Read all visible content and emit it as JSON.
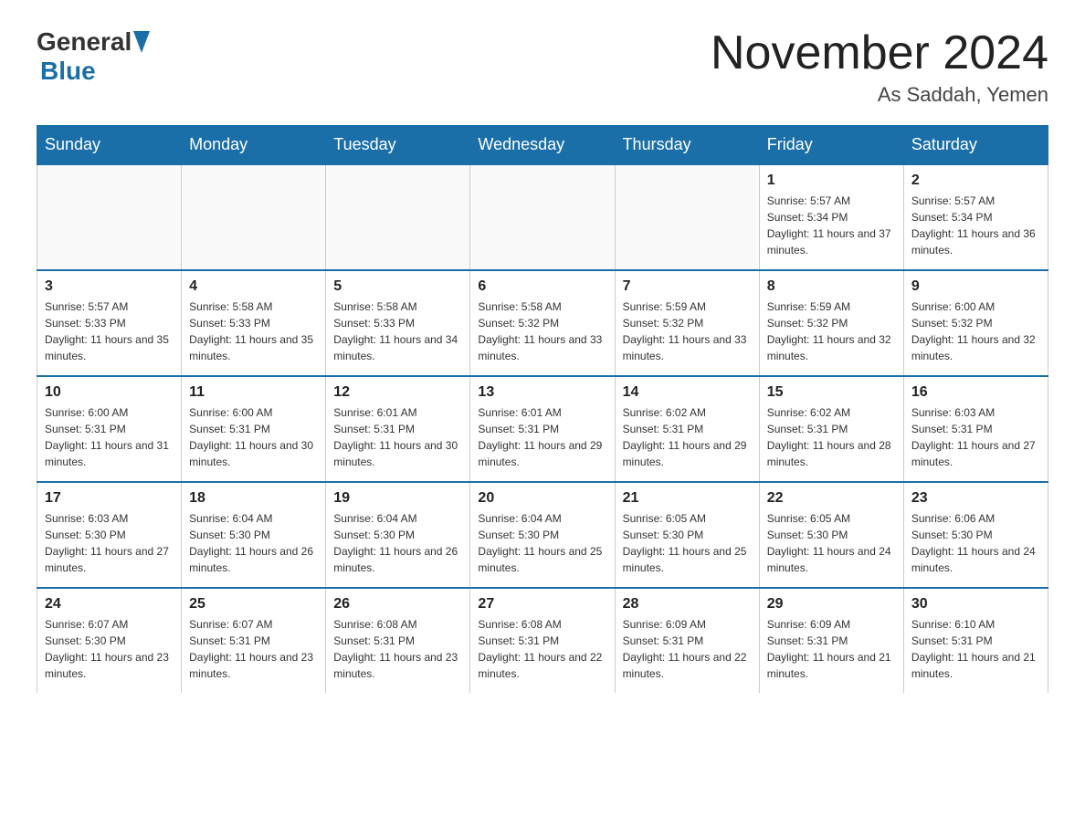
{
  "header": {
    "logo_general": "General",
    "logo_blue": "Blue",
    "month_title": "November 2024",
    "location": "As Saddah, Yemen"
  },
  "weekdays": [
    "Sunday",
    "Monday",
    "Tuesday",
    "Wednesday",
    "Thursday",
    "Friday",
    "Saturday"
  ],
  "weeks": [
    [
      {
        "day": "",
        "sunrise": "",
        "sunset": "",
        "daylight": ""
      },
      {
        "day": "",
        "sunrise": "",
        "sunset": "",
        "daylight": ""
      },
      {
        "day": "",
        "sunrise": "",
        "sunset": "",
        "daylight": ""
      },
      {
        "day": "",
        "sunrise": "",
        "sunset": "",
        "daylight": ""
      },
      {
        "day": "",
        "sunrise": "",
        "sunset": "",
        "daylight": ""
      },
      {
        "day": "1",
        "sunrise": "Sunrise: 5:57 AM",
        "sunset": "Sunset: 5:34 PM",
        "daylight": "Daylight: 11 hours and 37 minutes."
      },
      {
        "day": "2",
        "sunrise": "Sunrise: 5:57 AM",
        "sunset": "Sunset: 5:34 PM",
        "daylight": "Daylight: 11 hours and 36 minutes."
      }
    ],
    [
      {
        "day": "3",
        "sunrise": "Sunrise: 5:57 AM",
        "sunset": "Sunset: 5:33 PM",
        "daylight": "Daylight: 11 hours and 35 minutes."
      },
      {
        "day": "4",
        "sunrise": "Sunrise: 5:58 AM",
        "sunset": "Sunset: 5:33 PM",
        "daylight": "Daylight: 11 hours and 35 minutes."
      },
      {
        "day": "5",
        "sunrise": "Sunrise: 5:58 AM",
        "sunset": "Sunset: 5:33 PM",
        "daylight": "Daylight: 11 hours and 34 minutes."
      },
      {
        "day": "6",
        "sunrise": "Sunrise: 5:58 AM",
        "sunset": "Sunset: 5:32 PM",
        "daylight": "Daylight: 11 hours and 33 minutes."
      },
      {
        "day": "7",
        "sunrise": "Sunrise: 5:59 AM",
        "sunset": "Sunset: 5:32 PM",
        "daylight": "Daylight: 11 hours and 33 minutes."
      },
      {
        "day": "8",
        "sunrise": "Sunrise: 5:59 AM",
        "sunset": "Sunset: 5:32 PM",
        "daylight": "Daylight: 11 hours and 32 minutes."
      },
      {
        "day": "9",
        "sunrise": "Sunrise: 6:00 AM",
        "sunset": "Sunset: 5:32 PM",
        "daylight": "Daylight: 11 hours and 32 minutes."
      }
    ],
    [
      {
        "day": "10",
        "sunrise": "Sunrise: 6:00 AM",
        "sunset": "Sunset: 5:31 PM",
        "daylight": "Daylight: 11 hours and 31 minutes."
      },
      {
        "day": "11",
        "sunrise": "Sunrise: 6:00 AM",
        "sunset": "Sunset: 5:31 PM",
        "daylight": "Daylight: 11 hours and 30 minutes."
      },
      {
        "day": "12",
        "sunrise": "Sunrise: 6:01 AM",
        "sunset": "Sunset: 5:31 PM",
        "daylight": "Daylight: 11 hours and 30 minutes."
      },
      {
        "day": "13",
        "sunrise": "Sunrise: 6:01 AM",
        "sunset": "Sunset: 5:31 PM",
        "daylight": "Daylight: 11 hours and 29 minutes."
      },
      {
        "day": "14",
        "sunrise": "Sunrise: 6:02 AM",
        "sunset": "Sunset: 5:31 PM",
        "daylight": "Daylight: 11 hours and 29 minutes."
      },
      {
        "day": "15",
        "sunrise": "Sunrise: 6:02 AM",
        "sunset": "Sunset: 5:31 PM",
        "daylight": "Daylight: 11 hours and 28 minutes."
      },
      {
        "day": "16",
        "sunrise": "Sunrise: 6:03 AM",
        "sunset": "Sunset: 5:31 PM",
        "daylight": "Daylight: 11 hours and 27 minutes."
      }
    ],
    [
      {
        "day": "17",
        "sunrise": "Sunrise: 6:03 AM",
        "sunset": "Sunset: 5:30 PM",
        "daylight": "Daylight: 11 hours and 27 minutes."
      },
      {
        "day": "18",
        "sunrise": "Sunrise: 6:04 AM",
        "sunset": "Sunset: 5:30 PM",
        "daylight": "Daylight: 11 hours and 26 minutes."
      },
      {
        "day": "19",
        "sunrise": "Sunrise: 6:04 AM",
        "sunset": "Sunset: 5:30 PM",
        "daylight": "Daylight: 11 hours and 26 minutes."
      },
      {
        "day": "20",
        "sunrise": "Sunrise: 6:04 AM",
        "sunset": "Sunset: 5:30 PM",
        "daylight": "Daylight: 11 hours and 25 minutes."
      },
      {
        "day": "21",
        "sunrise": "Sunrise: 6:05 AM",
        "sunset": "Sunset: 5:30 PM",
        "daylight": "Daylight: 11 hours and 25 minutes."
      },
      {
        "day": "22",
        "sunrise": "Sunrise: 6:05 AM",
        "sunset": "Sunset: 5:30 PM",
        "daylight": "Daylight: 11 hours and 24 minutes."
      },
      {
        "day": "23",
        "sunrise": "Sunrise: 6:06 AM",
        "sunset": "Sunset: 5:30 PM",
        "daylight": "Daylight: 11 hours and 24 minutes."
      }
    ],
    [
      {
        "day": "24",
        "sunrise": "Sunrise: 6:07 AM",
        "sunset": "Sunset: 5:30 PM",
        "daylight": "Daylight: 11 hours and 23 minutes."
      },
      {
        "day": "25",
        "sunrise": "Sunrise: 6:07 AM",
        "sunset": "Sunset: 5:31 PM",
        "daylight": "Daylight: 11 hours and 23 minutes."
      },
      {
        "day": "26",
        "sunrise": "Sunrise: 6:08 AM",
        "sunset": "Sunset: 5:31 PM",
        "daylight": "Daylight: 11 hours and 23 minutes."
      },
      {
        "day": "27",
        "sunrise": "Sunrise: 6:08 AM",
        "sunset": "Sunset: 5:31 PM",
        "daylight": "Daylight: 11 hours and 22 minutes."
      },
      {
        "day": "28",
        "sunrise": "Sunrise: 6:09 AM",
        "sunset": "Sunset: 5:31 PM",
        "daylight": "Daylight: 11 hours and 22 minutes."
      },
      {
        "day": "29",
        "sunrise": "Sunrise: 6:09 AM",
        "sunset": "Sunset: 5:31 PM",
        "daylight": "Daylight: 11 hours and 21 minutes."
      },
      {
        "day": "30",
        "sunrise": "Sunrise: 6:10 AM",
        "sunset": "Sunset: 5:31 PM",
        "daylight": "Daylight: 11 hours and 21 minutes."
      }
    ]
  ]
}
